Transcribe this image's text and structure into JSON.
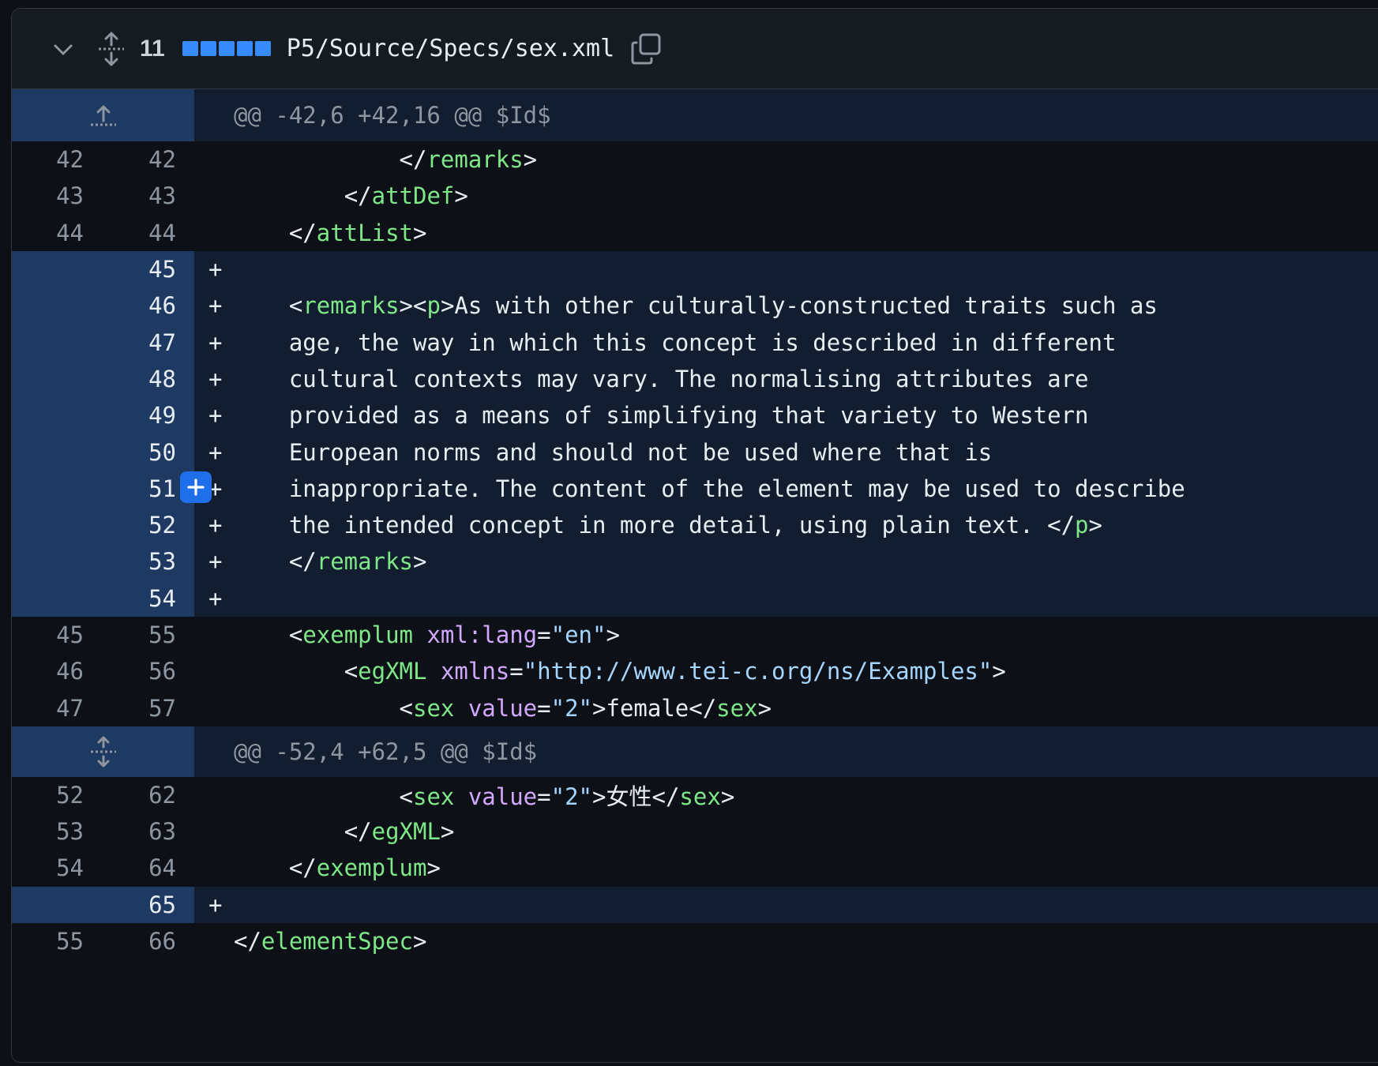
{
  "file": {
    "changed_lines": "11",
    "diffstat_blocks": 5,
    "path": "P5/Source/Specs/sex.xml"
  },
  "hunks": [
    {
      "header": "@@ -42,6 +42,16 @@ $Id$"
    },
    {
      "header": "@@ -52,4 +62,5 @@ $Id$"
    }
  ],
  "lines": [
    {
      "old": "42",
      "new": "42",
      "type": "ctx",
      "code": "            </remarks>"
    },
    {
      "old": "43",
      "new": "43",
      "type": "ctx",
      "code": "        </attDef>"
    },
    {
      "old": "44",
      "new": "44",
      "type": "ctx",
      "code": "    </attList>"
    },
    {
      "old": "",
      "new": "45",
      "type": "add",
      "code": ""
    },
    {
      "old": "",
      "new": "46",
      "type": "add",
      "code": "    <remarks><p>As with other culturally-constructed traits such as"
    },
    {
      "old": "",
      "new": "47",
      "type": "add",
      "code": "    age, the way in which this concept is described in different"
    },
    {
      "old": "",
      "new": "48",
      "type": "add",
      "code": "    cultural contexts may vary. The normalising attributes are"
    },
    {
      "old": "",
      "new": "49",
      "type": "add",
      "code": "    provided as a means of simplifying that variety to Western"
    },
    {
      "old": "",
      "new": "50",
      "type": "add",
      "code": "    European norms and should not be used where that is"
    },
    {
      "old": "",
      "new": "51",
      "type": "add",
      "code": "    inappropriate. The content of the element may be used to describe"
    },
    {
      "old": "",
      "new": "52",
      "type": "add",
      "code": "    the intended concept in more detail, using plain text. </p>"
    },
    {
      "old": "",
      "new": "53",
      "type": "add",
      "code": "    </remarks>"
    },
    {
      "old": "",
      "new": "54",
      "type": "add",
      "code": ""
    },
    {
      "old": "45",
      "new": "55",
      "type": "ctx",
      "code": "    <exemplum xml:lang=\"en\">"
    },
    {
      "old": "46",
      "new": "56",
      "type": "ctx",
      "code": "        <egXML xmlns=\"http://www.tei-c.org/ns/Examples\">"
    },
    {
      "old": "47",
      "new": "57",
      "type": "ctx",
      "code": "            <sex value=\"2\">female</sex>"
    },
    {
      "old": "52",
      "new": "62",
      "type": "ctx",
      "code": "            <sex value=\"2\">女性</sex>"
    },
    {
      "old": "53",
      "new": "63",
      "type": "ctx",
      "code": "        </egXML>"
    },
    {
      "old": "54",
      "new": "64",
      "type": "ctx",
      "code": "    </exemplum>"
    },
    {
      "old": "",
      "new": "65",
      "type": "add",
      "code": ""
    },
    {
      "old": "55",
      "new": "66",
      "type": "ctx",
      "code": "</elementSpec>"
    }
  ],
  "add_marker": "+",
  "colors": {
    "background": "#0d1117",
    "added_row": "#121d2f",
    "added_gutter": "#1f3a62",
    "accent": "#388bfd",
    "comment_button": "#1f6feb",
    "tag_name": "#7ee787",
    "attr_name": "#d2a8ff",
    "attr_value": "#a5d6ff",
    "punctuation": "#e6edf3",
    "line_number": "#8d96a0"
  },
  "icons": {
    "collapse": "chevron-down-icon",
    "expand": "expand-icon",
    "copy": "copy-icon",
    "expand_up": "expand-up-icon",
    "add_comment": "plus-icon"
  }
}
